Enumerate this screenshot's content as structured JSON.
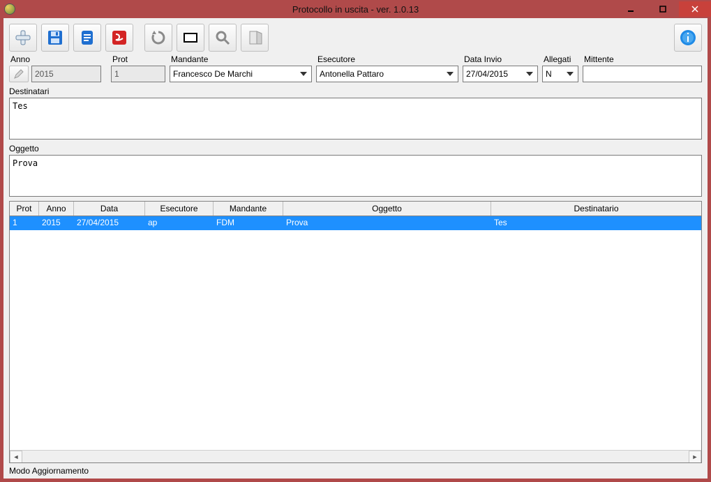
{
  "window": {
    "title": "Protocollo in uscita - ver. 1.0.13"
  },
  "toolbar": {
    "new": "new",
    "save": "save",
    "open": "open",
    "pdf": "pdf",
    "refresh": "refresh",
    "preview": "preview",
    "search": "search",
    "exit": "exit",
    "info": "info"
  },
  "form": {
    "anno": {
      "label": "Anno",
      "value": "2015"
    },
    "prot": {
      "label": "Prot",
      "value": "1"
    },
    "mandante": {
      "label": "Mandante",
      "value": "Francesco De Marchi"
    },
    "esecutore": {
      "label": "Esecutore",
      "value": "Antonella Pattaro"
    },
    "dataInvio": {
      "label": "Data Invio",
      "value": "27/04/2015"
    },
    "allegati": {
      "label": "Allegati",
      "value": "N"
    },
    "mittente": {
      "label": "Mittente",
      "value": ""
    },
    "destinatari": {
      "label": "Destinatari",
      "value": "Tes"
    },
    "oggetto": {
      "label": "Oggetto",
      "value": "Prova"
    }
  },
  "grid": {
    "headers": {
      "prot": "Prot",
      "anno": "Anno",
      "data": "Data",
      "esecutore": "Esecutore",
      "mandante": "Mandante",
      "oggetto": "Oggetto",
      "destinatario": "Destinatario"
    },
    "rows": [
      {
        "prot": "1",
        "anno": "2015",
        "data": "27/04/2015",
        "esecutore": "ap",
        "mandante": "FDM",
        "oggetto": "Prova",
        "destinatario": "Tes",
        "selected": true
      }
    ]
  },
  "status": {
    "text": "Modo Aggiornamento"
  }
}
